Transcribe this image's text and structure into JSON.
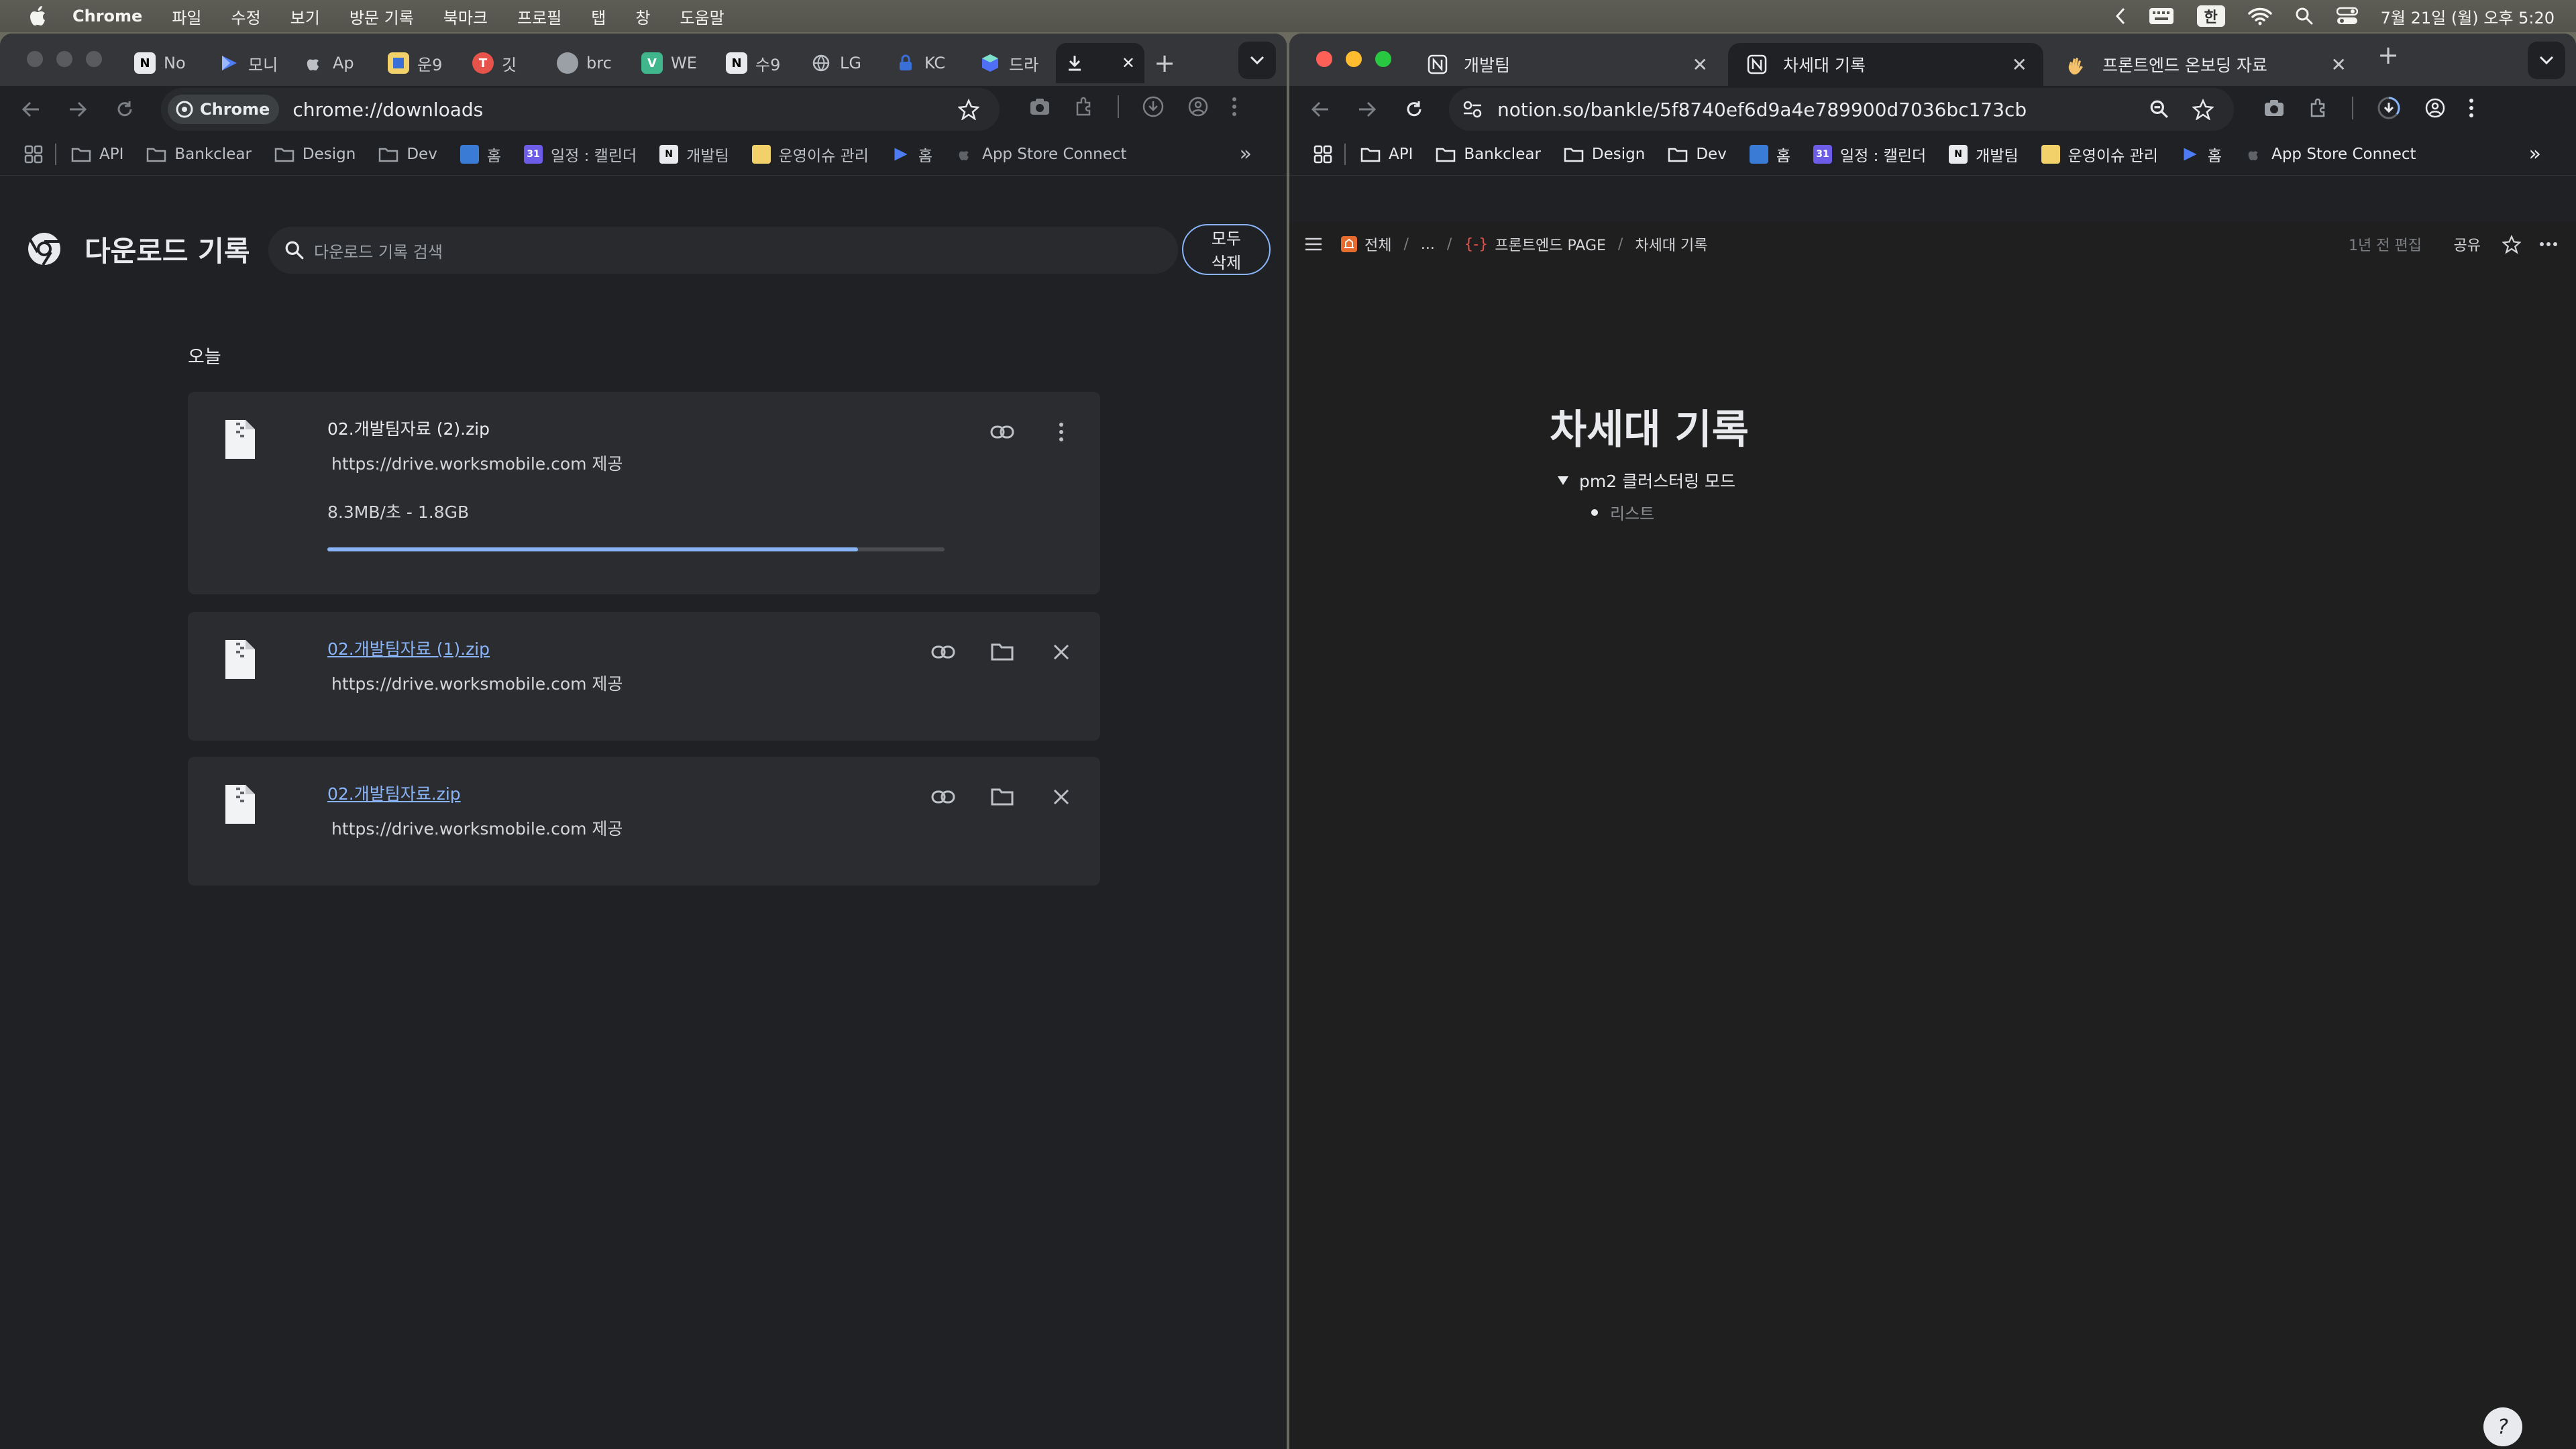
{
  "menubar": {
    "app": "Chrome",
    "items": [
      "파일",
      "수정",
      "보기",
      "방문 기록",
      "북마크",
      "프로필",
      "탭",
      "창",
      "도움말"
    ],
    "ime": "한",
    "clock": "7월 21일 (월) 오후 5:20"
  },
  "left_window": {
    "tabs": [
      {
        "label": "No",
        "icon": "notion-icon"
      },
      {
        "label": "모니",
        "icon": "flag-icon"
      },
      {
        "label": "Ap",
        "icon": "apple-icon"
      },
      {
        "label": "운9",
        "icon": "app-icon"
      },
      {
        "label": "깃",
        "icon": "red-circle-icon"
      },
      {
        "label": "brc",
        "icon": "globe-icon"
      },
      {
        "label": "WE",
        "icon": "v-icon"
      },
      {
        "label": "수9",
        "icon": "notion-icon"
      },
      {
        "label": "LG",
        "icon": "globe-icon"
      },
      {
        "label": "KC",
        "icon": "lock-icon"
      },
      {
        "label": "드라",
        "icon": "cube-icon"
      }
    ],
    "active_tab_icon": "download-icon",
    "address": {
      "chip": "Chrome",
      "url": "chrome://downloads"
    },
    "bookmarks": [
      "API",
      "Bankclear",
      "Design",
      "Dev",
      "홈",
      "일정 : 캘린더",
      "개발팀",
      "운영이슈 관리",
      "홈",
      "App Store Connect"
    ],
    "downloads": {
      "title": "다운로드 기록",
      "search_placeholder": "다운로드 기록 검색",
      "clear_all_line1": "모두",
      "clear_all_line2": "삭제",
      "section": "오늘",
      "items": [
        {
          "name": "02.개발팀자료 (2).zip",
          "source": "https://drive.worksmobile.com 제공",
          "status": "8.3MB/초 - 1.8GB",
          "progress": 0.86
        },
        {
          "name": "02.개발팀자료 (1).zip",
          "source": "https://drive.worksmobile.com 제공"
        },
        {
          "name": "02.개발팀자료.zip",
          "source": "https://drive.worksmobile.com 제공"
        }
      ]
    }
  },
  "right_window": {
    "tabs": [
      {
        "label": "개발팀",
        "icon": "notion-icon"
      },
      {
        "label": "차세대 기록",
        "icon": "notion-icon"
      },
      {
        "label": "프론트엔드 온보딩 자료",
        "icon": "wave-hand-icon"
      }
    ],
    "address": {
      "url": "notion.so/bankle/5f8740ef6d9a4e789900d7036bc173cb"
    },
    "bookmarks": [
      "API",
      "Bankclear",
      "Design",
      "Dev",
      "홈",
      "일정 : 캘린더",
      "개발팀",
      "운영이슈 관리",
      "홈",
      "App Store Connect"
    ],
    "notion": {
      "breadcrumb": [
        "전체",
        "...",
        "프론트엔드 PAGE",
        "차세대 기록"
      ],
      "edited": "1년 전 편집",
      "share": "공유",
      "title": "차세대 기록",
      "toggle": "pm2 클러스터링 모드",
      "bullet": "리스트",
      "help": "?"
    }
  },
  "colors": {
    "accent": "#8ab4f8",
    "page_bg": "#202124",
    "tab_strip": "#35363a",
    "card": "#2b2c30"
  }
}
